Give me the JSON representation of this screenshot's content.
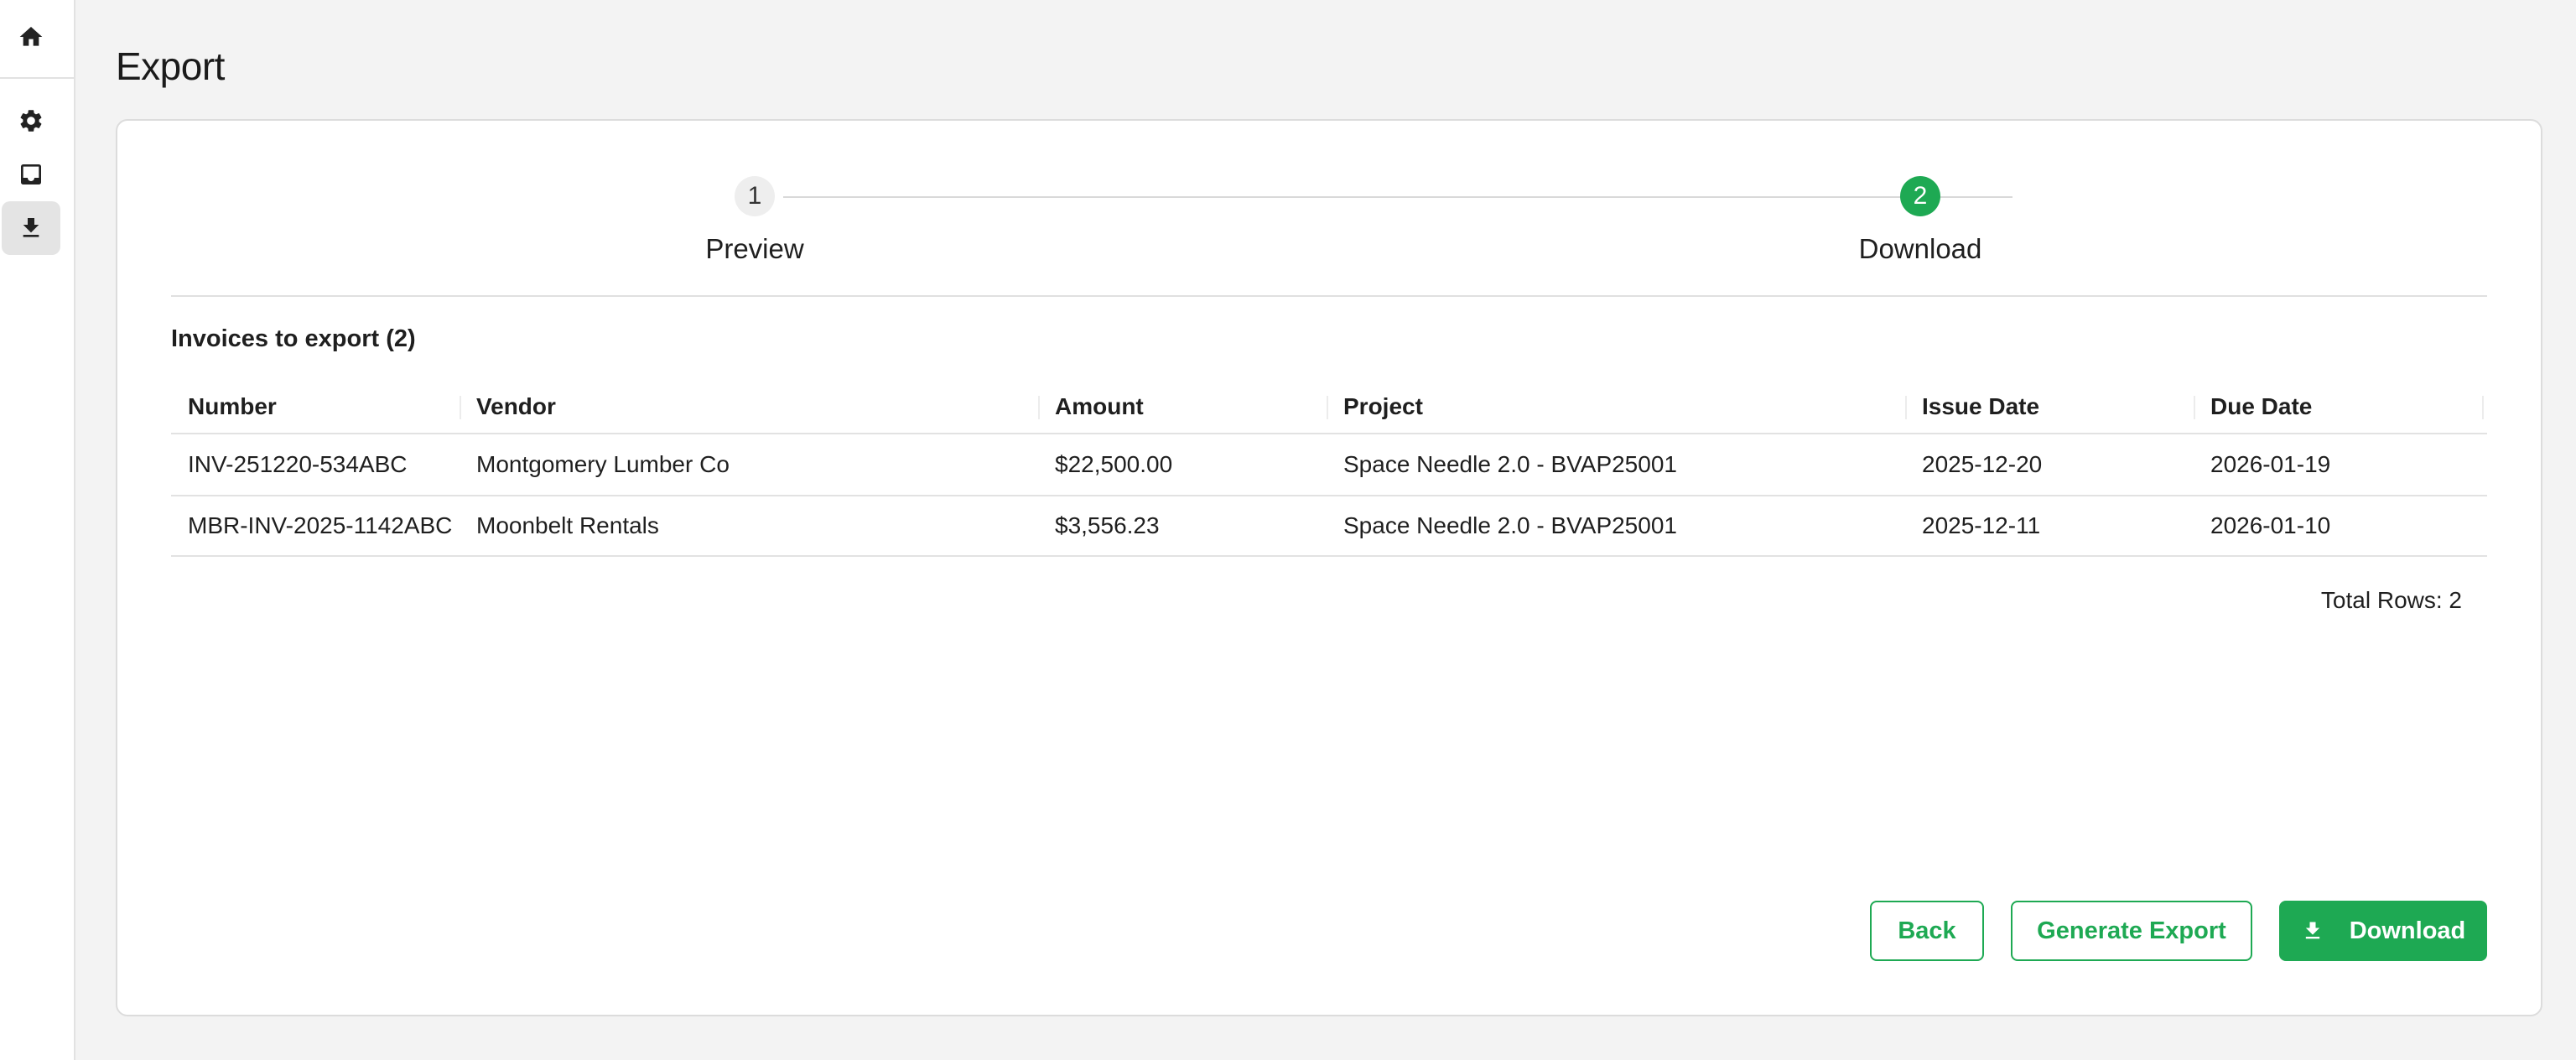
{
  "sidebar": {
    "items": [
      {
        "icon": "home-icon"
      },
      {
        "icon": "gear-icon"
      },
      {
        "icon": "inbox-icon"
      },
      {
        "icon": "download-icon",
        "active": true
      }
    ]
  },
  "page": {
    "title": "Export"
  },
  "stepper": {
    "steps": [
      {
        "number": "1",
        "label": "Preview",
        "state": "completed"
      },
      {
        "number": "2",
        "label": "Download",
        "state": "active"
      }
    ]
  },
  "section": {
    "title": "Invoices to export (2)"
  },
  "table": {
    "headers": [
      "Number",
      "Vendor",
      "Amount",
      "Project",
      "Issue Date",
      "Due Date"
    ],
    "rows": [
      [
        "INV-251220-534ABC",
        "Montgomery Lumber Co",
        "$22,500.00",
        "Space Needle 2.0 - BVAP25001",
        "2025-12-20",
        "2026-01-19"
      ],
      [
        "MBR-INV-2025-1142ABC",
        "Moonbelt Rentals",
        "$3,556.23",
        "Space Needle 2.0 - BVAP25001",
        "2025-12-11",
        "2026-01-10"
      ]
    ],
    "total_rows": "Total Rows: 2"
  },
  "actions": {
    "back": "Back",
    "generate": "Generate Export",
    "download": "Download"
  },
  "colors": {
    "accent": "#1ea953",
    "background": "#f3f3f3",
    "card": "#ffffff"
  }
}
